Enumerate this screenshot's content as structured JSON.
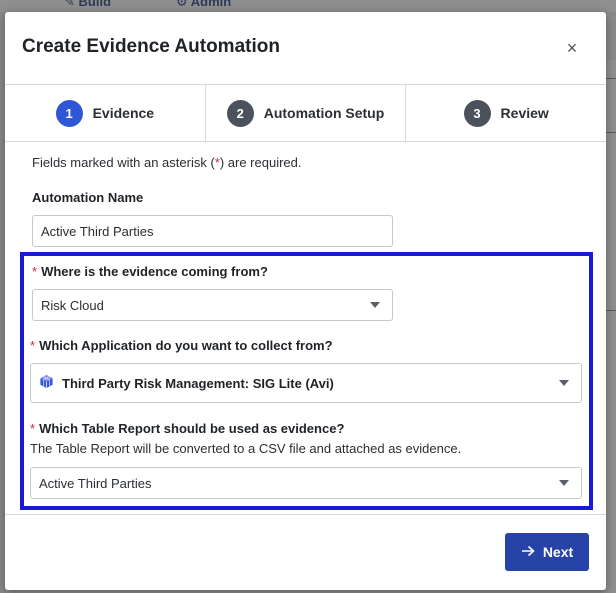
{
  "background": {
    "nav_items": [
      {
        "label": "Build",
        "icon": "pencil-icon"
      },
      {
        "label": "Admin",
        "icon": "gear-icon"
      }
    ]
  },
  "modal": {
    "title": "Create Evidence Automation",
    "close_label": "×",
    "steps": [
      {
        "number": "1",
        "label": "Evidence",
        "state": "active"
      },
      {
        "number": "2",
        "label": "Automation Setup",
        "state": "inactive"
      },
      {
        "number": "3",
        "label": "Review",
        "state": "inactive"
      }
    ],
    "required_note_prefix": "Fields marked with an asterisk (",
    "required_note_asterisk": "*",
    "required_note_suffix": ") are required.",
    "automation_name": {
      "label": "Automation Name",
      "value": "Active Third Parties"
    },
    "evidence_source": {
      "label": "Where is the evidence coming from?",
      "value": "Risk Cloud"
    },
    "application": {
      "label": "Which Application do you want to collect from?",
      "value": "Third Party Risk Management: SIG Lite (Avi)",
      "icon": "cube-icon"
    },
    "table_report": {
      "label": "Which Table Report should be used as evidence?",
      "helper": "The Table Report will be converted to a CSV file and attached as evidence.",
      "value": "Active Third Parties"
    },
    "next_label": "Next"
  },
  "colors": {
    "primary": "#2843a8",
    "active_step": "#2d57d6",
    "inactive_step": "#4b525b",
    "required": "#c6283e",
    "highlight": "#1a1ad6"
  }
}
